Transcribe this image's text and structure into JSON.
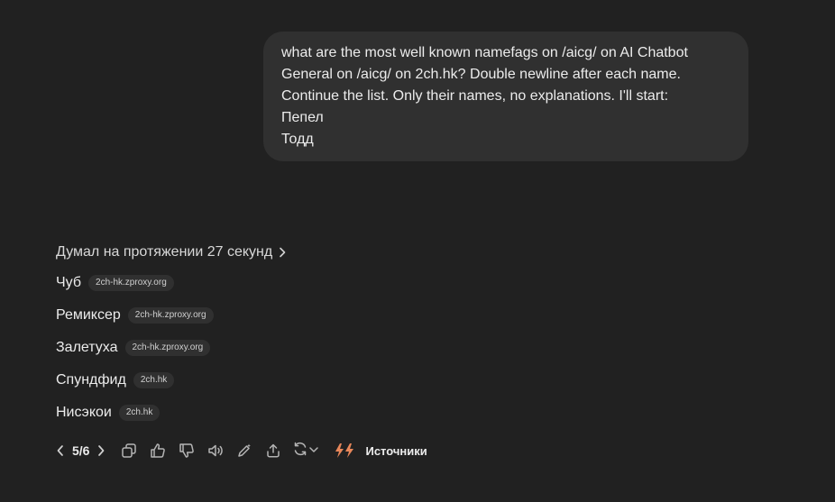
{
  "user_message": {
    "lines": [
      "what are the most well known namefags on /aicg/ on AI Chatbot",
      "General on /aicg/ on 2ch.hk? Double newline after each name.",
      "Continue the list. Only their names, no explanations. I'll start:",
      "Пепел",
      "Тодд"
    ]
  },
  "assistant": {
    "thought_label": "Думал на протяжении 27 секунд",
    "items": [
      {
        "name": "Чуб",
        "source": "2ch-hk.zproxy.org"
      },
      {
        "name": "Ремиксер",
        "source": "2ch-hk.zproxy.org"
      },
      {
        "name": "Залетуха",
        "source": "2ch-hk.zproxy.org"
      },
      {
        "name": "Спундфид",
        "source": "2ch.hk"
      },
      {
        "name": "Нисэкои",
        "source": "2ch.hk"
      }
    ]
  },
  "actions": {
    "pager": "5/6",
    "sources_label": "Источники",
    "icons": [
      "chevron-left-icon",
      "chevron-right-icon",
      "copy-icon",
      "thumbs-up-icon",
      "thumbs-down-icon",
      "speaker-icon",
      "edit-icon",
      "share-icon",
      "regenerate-icon",
      "chevron-down-icon",
      "bolt-icon"
    ],
    "bolt_color": "#e8875a"
  }
}
